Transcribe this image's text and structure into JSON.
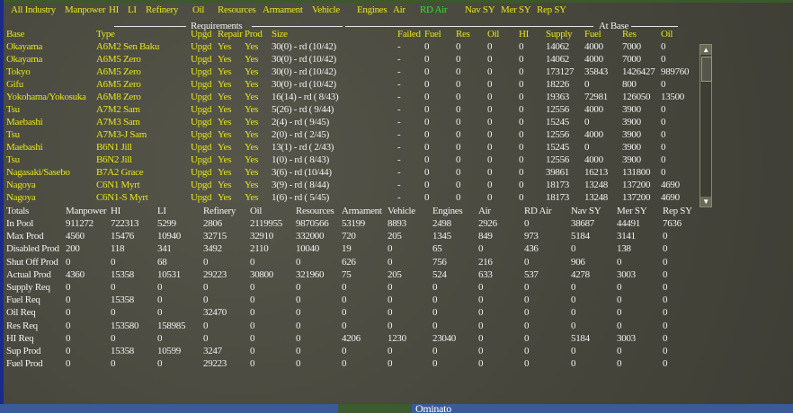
{
  "menu": [
    {
      "label": "All Industry",
      "active": false
    },
    {
      "label": "Manpower",
      "active": false
    },
    {
      "label": "HI",
      "active": false
    },
    {
      "label": "LI",
      "active": false
    },
    {
      "label": "Refinery",
      "active": false
    },
    {
      "label": "Oil",
      "active": false
    },
    {
      "label": "Resources",
      "active": false
    },
    {
      "label": "Armament",
      "active": false
    },
    {
      "label": "Vehicle",
      "active": false
    },
    {
      "label": "Engines",
      "active": false
    },
    {
      "label": "Air",
      "active": false
    },
    {
      "label": "RD Air",
      "active": true
    },
    {
      "label": "Nav SY",
      "active": false
    },
    {
      "label": "Mer SY",
      "active": false
    },
    {
      "label": "Rep SY",
      "active": false
    }
  ],
  "group_headers": {
    "requirements": "Requirements",
    "at_base": "At Base"
  },
  "columns": [
    "Base",
    "Type",
    "Upgd",
    "Repair",
    "Prod",
    "Size",
    "Failed",
    "Fuel",
    "Res",
    "Oil",
    "HI",
    "Supply",
    "Fuel",
    "Res",
    "Oil"
  ],
  "rows": [
    [
      "Okayama",
      "A6M2 Sen Baku",
      "Upgd",
      "Yes",
      "Yes",
      "30(0) - rd (10/42)",
      "-",
      "0",
      "0",
      "0",
      "0",
      "14062",
      "4000",
      "7000",
      "0"
    ],
    [
      "Okayama",
      "A6M5 Zero",
      "Upgd",
      "Yes",
      "Yes",
      "30(0) - rd (10/42)",
      "-",
      "0",
      "0",
      "0",
      "0",
      "14062",
      "4000",
      "7000",
      "0"
    ],
    [
      "Tokyo",
      "A6M5 Zero",
      "Upgd",
      "Yes",
      "Yes",
      "30(0) - rd (10/42)",
      "-",
      "0",
      "0",
      "0",
      "0",
      "173127",
      "35843",
      "1426427",
      "989760"
    ],
    [
      "Gifu",
      "A6M5 Zero",
      "Upgd",
      "Yes",
      "Yes",
      "30(0) - rd (10/42)",
      "-",
      "0",
      "0",
      "0",
      "0",
      "18226",
      "0",
      "800",
      "0"
    ],
    [
      "Yokohama/Yokosuka",
      "A6M8 Zero",
      "Upgd",
      "Yes",
      "Yes",
      "16(14) - rd ( 8/43)",
      "-",
      "0",
      "0",
      "0",
      "0",
      "19363",
      "72981",
      "126050",
      "13500"
    ],
    [
      "Tsu",
      "A7M2 Sam",
      "Upgd",
      "Yes",
      "Yes",
      "5(26) - rd ( 9/44)",
      "-",
      "0",
      "0",
      "0",
      "0",
      "12556",
      "4000",
      "3900",
      "0"
    ],
    [
      "Maebashi",
      "A7M3 Sam",
      "Upgd",
      "Yes",
      "Yes",
      "2(4) - rd ( 9/45)",
      "-",
      "0",
      "0",
      "0",
      "0",
      "15245",
      "0",
      "3900",
      "0"
    ],
    [
      "Tsu",
      "A7M3-J Sam",
      "Upgd",
      "Yes",
      "Yes",
      "2(0) - rd ( 2/45)",
      "-",
      "0",
      "0",
      "0",
      "0",
      "12556",
      "4000",
      "3900",
      "0"
    ],
    [
      "Maebashi",
      "B6N1 Jill",
      "Upgd",
      "Yes",
      "Yes",
      "13(1) - rd ( 2/43)",
      "-",
      "0",
      "0",
      "0",
      "0",
      "15245",
      "0",
      "3900",
      "0"
    ],
    [
      "Tsu",
      "B6N2 Jill",
      "Upgd",
      "Yes",
      "Yes",
      "1(0) - rd ( 8/43)",
      "-",
      "0",
      "0",
      "0",
      "0",
      "12556",
      "4000",
      "3900",
      "0"
    ],
    [
      "Nagasaki/Sasebo",
      "B7A2 Grace",
      "Upgd",
      "Yes",
      "Yes",
      "3(6) - rd (10/44)",
      "-",
      "0",
      "0",
      "0",
      "0",
      "39861",
      "16213",
      "131800",
      "0"
    ],
    [
      "Nagoya",
      "C6N1 Myrt",
      "Upgd",
      "Yes",
      "Yes",
      "3(9) - rd ( 8/44)",
      "-",
      "0",
      "0",
      "0",
      "0",
      "18173",
      "13248",
      "137200",
      "4690"
    ],
    [
      "Nagoya",
      "C6N1-S Myrt",
      "Upgd",
      "Yes",
      "Yes",
      "1(6) - rd ( 5/45)",
      "-",
      "0",
      "0",
      "0",
      "0",
      "18173",
      "13248",
      "137200",
      "4690"
    ]
  ],
  "totals": {
    "columns": [
      "Totals",
      "Manpower",
      "HI",
      "LI",
      "Refinery",
      "Oil",
      "Resources",
      "Armament",
      "Vehicle",
      "Engines",
      "Air",
      "RD Air",
      "Nav SY",
      "Mer SY",
      "Rep SY"
    ],
    "rows": [
      [
        "In Pool",
        "911272",
        "722313",
        "5299",
        "2806",
        "2119955",
        "9870566",
        "53199",
        "8893",
        "2498",
        "2926",
        "0",
        "38687",
        "44491",
        "7636"
      ],
      [
        "Max Prod",
        "4560",
        "15476",
        "10940",
        "32715",
        "32910",
        "332000",
        "720",
        "205",
        "1345",
        "849",
        "973",
        "5184",
        "3141",
        "0"
      ],
      [
        "Disabled Prod",
        "200",
        "118",
        "341",
        "3492",
        "2110",
        "10040",
        "19",
        "0",
        "65",
        "0",
        "436",
        "0",
        "138",
        "0"
      ],
      [
        "Shut Off Prod",
        "0",
        "0",
        "68",
        "0",
        "0",
        "0",
        "626",
        "0",
        "756",
        "216",
        "0",
        "906",
        "0",
        "0"
      ],
      [
        "Actual Prod",
        "4360",
        "15358",
        "10531",
        "29223",
        "30800",
        "321960",
        "75",
        "205",
        "524",
        "633",
        "537",
        "4278",
        "3003",
        "0"
      ],
      [
        "Supply Req",
        "0",
        "0",
        "0",
        "0",
        "0",
        "0",
        "0",
        "0",
        "0",
        "0",
        "0",
        "0",
        "0",
        "0"
      ],
      [
        "Fuel Req",
        "0",
        "15358",
        "0",
        "0",
        "0",
        "0",
        "0",
        "0",
        "0",
        "0",
        "0",
        "0",
        "0",
        "0"
      ],
      [
        "Oil Req",
        "0",
        "0",
        "0",
        "32470",
        "0",
        "0",
        "0",
        "0",
        "0",
        "0",
        "0",
        "0",
        "0",
        "0"
      ],
      [
        "Res Req",
        "0",
        "153580",
        "158985",
        "0",
        "0",
        "0",
        "0",
        "0",
        "0",
        "0",
        "0",
        "0",
        "0",
        "0"
      ],
      [
        "HI Req",
        "0",
        "0",
        "0",
        "0",
        "0",
        "0",
        "4206",
        "1230",
        "23040",
        "0",
        "0",
        "5184",
        "3003",
        "0"
      ],
      [
        "Sup Prod",
        "0",
        "15358",
        "10599",
        "3247",
        "0",
        "0",
        "0",
        "0",
        "0",
        "0",
        "0",
        "0",
        "0",
        "0"
      ],
      [
        "Fuel Prod",
        "0",
        "0",
        "0",
        "29223",
        "0",
        "0",
        "0",
        "0",
        "0",
        "0",
        "0",
        "0",
        "0",
        "0"
      ]
    ]
  },
  "map_label": "Ominato",
  "colors": {
    "yellow": "#e6e619",
    "white": "#f2f2f2",
    "active": "#29e629",
    "panel": "#4a4a40"
  }
}
